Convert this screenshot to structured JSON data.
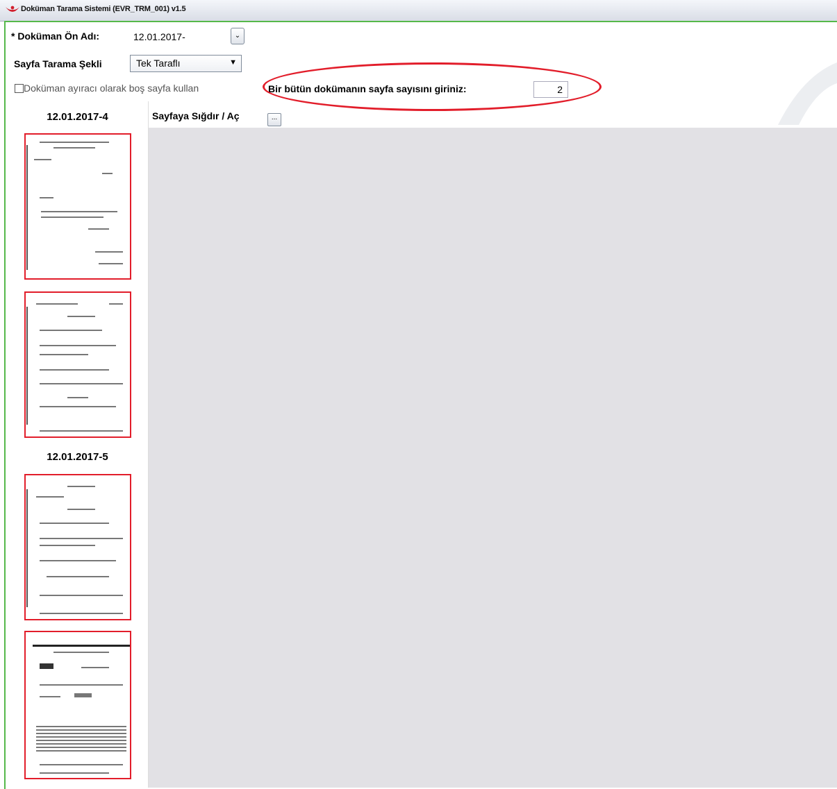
{
  "window": {
    "title": "Doküman Tarama Sistemi (EVR_TRM_001) v1.5"
  },
  "form": {
    "prefix_label": "* Doküman Ön Adı:",
    "prefix_value": "12.01.2017-",
    "scan_mode_label": "Sayfa Tarama Şekli",
    "scan_mode_value": "Tek Taraflı",
    "separator_label": "Doküman ayıracı olarak boş sayfa kullan",
    "separator_checked": false,
    "page_count_label": "Bir bütün dokümanın sayfa sayısını giriniz:",
    "page_count_value": "2"
  },
  "viewer": {
    "fit_label": "Sayfaya Sığdır / Aç",
    "fit_button": "..."
  },
  "documents": [
    {
      "name": "12.01.2017-4",
      "pages": 2
    },
    {
      "name": "12.01.2017-5",
      "pages": 2
    }
  ],
  "colors": {
    "highlight": "#e21d2a",
    "frame": "#55b84a",
    "viewer_bg": "#e2e1e5"
  },
  "icons": {
    "app_logo": "app-logo-icon",
    "dropdown": "chevron-down-icon"
  }
}
